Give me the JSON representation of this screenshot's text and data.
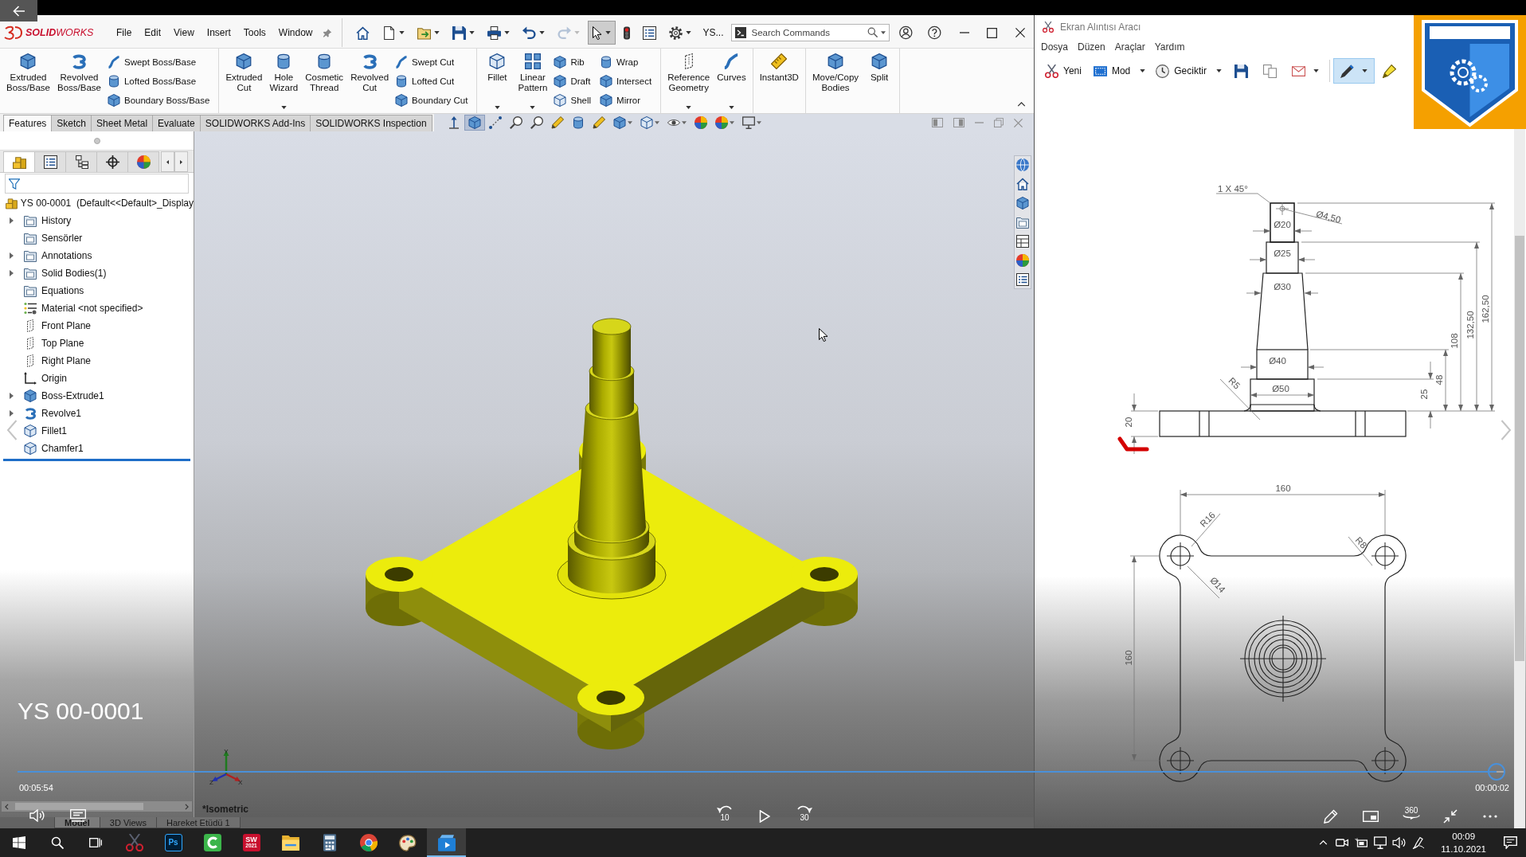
{
  "player": {
    "title": "YS 00-0001",
    "elapsed": "00:05:54",
    "remaining": "00:00:02",
    "level": 0.994,
    "rewind_label": "10",
    "forward_label": "30",
    "view360_label": "360"
  },
  "solidworks": {
    "brand": "**SOLID**WORKS",
    "menu": [
      "File",
      "Edit",
      "View",
      "Insert",
      "Tools",
      "Window"
    ],
    "quick_access": [
      {
        "kind": "home",
        "dropdown": false,
        "selected": false,
        "disabled": false
      },
      {
        "kind": "new",
        "dropdown": true,
        "selected": false,
        "disabled": false
      },
      {
        "kind": "open",
        "dropdown": true,
        "selected": false,
        "disabled": false
      },
      {
        "kind": "save",
        "dropdown": true,
        "selected": false,
        "disabled": false
      },
      {
        "kind": "print",
        "dropdown": true,
        "selected": false,
        "disabled": false
      },
      {
        "kind": "undo",
        "dropdown": true,
        "selected": false,
        "disabled": false
      },
      {
        "kind": "redo",
        "dropdown": true,
        "selected": false,
        "disabled": true
      },
      {
        "kind": "select",
        "dropdown": true,
        "selected": true,
        "disabled": false
      },
      {
        "kind": "rebuild",
        "dropdown": false,
        "selected": false,
        "disabled": false
      },
      {
        "kind": "file_properties",
        "dropdown": false,
        "selected": false,
        "disabled": false
      },
      {
        "kind": "options",
        "dropdown": true,
        "selected": false,
        "disabled": false
      }
    ],
    "document_label": "YS...",
    "search": {
      "placeholder": "Search Commands"
    },
    "ribbon": [
      [
        {
          "kind": "large",
          "label": "Extruded\nBoss/Base",
          "dropdown": false
        },
        {
          "kind": "large",
          "label": "Revolved\nBoss/Base",
          "dropdown": false
        },
        {
          "kind": "stack",
          "items": [
            "Swept Boss/Base",
            "Lofted Boss/Base",
            "Boundary Boss/Base"
          ]
        }
      ],
      [
        {
          "kind": "large",
          "label": "Extruded\nCut",
          "dropdown": false
        },
        {
          "kind": "large",
          "label": "Hole\nWizard",
          "dropdown": true
        },
        {
          "kind": "large",
          "label": "Cosmetic\nThread",
          "dropdown": false
        },
        {
          "kind": "large",
          "label": "Revolved\nCut",
          "dropdown": false
        },
        {
          "kind": "stack",
          "items": [
            "Swept Cut",
            "Lofted Cut",
            "Boundary Cut"
          ]
        }
      ],
      [
        {
          "kind": "large",
          "label": "Fillet",
          "dropdown": true
        },
        {
          "kind": "large",
          "label": "Linear\nPattern",
          "dropdown": true
        },
        {
          "kind": "stack",
          "items": [
            "Rib",
            "Draft",
            "Shell"
          ]
        },
        {
          "kind": "stack",
          "items": [
            "Wrap",
            "Intersect",
            "Mirror"
          ]
        }
      ],
      [
        {
          "kind": "large",
          "label": "Reference\nGeometry",
          "dropdown": true
        },
        {
          "kind": "large",
          "label": "Curves",
          "dropdown": true
        }
      ],
      [
        {
          "kind": "large",
          "label": "Instant3D",
          "dropdown": false
        }
      ],
      [
        {
          "kind": "large",
          "label": "Move/Copy\nBodies",
          "dropdown": false
        },
        {
          "kind": "large",
          "label": "Split",
          "dropdown": false
        }
      ]
    ],
    "tabs": [
      {
        "label": "Features",
        "selected": true
      },
      {
        "label": "Sketch",
        "selected": false
      },
      {
        "label": "Sheet Metal",
        "selected": false
      },
      {
        "label": "Evaluate",
        "selected": false
      },
      {
        "label": "SOLIDWORKS Add-Ins",
        "selected": false
      },
      {
        "label": "SOLIDWORKS Inspection",
        "selected": false
      }
    ],
    "view_tools": [
      {
        "selected": false,
        "dropdown": false
      },
      {
        "selected": true,
        "dropdown": false
      },
      {
        "selected": false,
        "dropdown": false
      },
      {
        "selected": false,
        "dropdown": false
      },
      {
        "selected": false,
        "dropdown": false
      },
      {
        "selected": false,
        "dropdown": false
      },
      {
        "selected": false,
        "dropdown": false
      },
      {
        "selected": false,
        "dropdown": false
      },
      {
        "selected": false,
        "dropdown": true
      },
      {
        "selected": false,
        "dropdown": true
      },
      {
        "selected": false,
        "dropdown": true
      },
      {
        "selected": false,
        "dropdown": false
      },
      {
        "selected": false,
        "dropdown": true
      },
      {
        "selected": false,
        "dropdown": true
      }
    ],
    "panel_tabs": [
      {
        "selected": true
      },
      {
        "selected": false
      },
      {
        "selected": false
      },
      {
        "selected": false
      },
      {
        "selected": false
      }
    ],
    "tree": {
      "root": "YS 00-0001  (Default<<Default>_Display",
      "items": [
        {
          "label": "History",
          "kind": "folder",
          "expandable": true
        },
        {
          "label": "Sensörler",
          "kind": "folder",
          "expandable": false
        },
        {
          "label": "Annotations",
          "kind": "folder",
          "expandable": true
        },
        {
          "label": "Solid Bodies(1)",
          "kind": "folder",
          "expandable": true
        },
        {
          "label": "Equations",
          "kind": "folder",
          "expandable": false
        },
        {
          "label": "Material <not specified>",
          "kind": "material",
          "expandable": false
        },
        {
          "label": "Front Plane",
          "kind": "plane",
          "expandable": false
        },
        {
          "label": "Top Plane",
          "kind": "plane",
          "expandable": false
        },
        {
          "label": "Right Plane",
          "kind": "plane",
          "expandable": false
        },
        {
          "label": "Origin",
          "kind": "origin",
          "expandable": false
        },
        {
          "label": "Boss-Extrude1",
          "kind": "extrude",
          "expandable": true
        },
        {
          "label": "Revolve1",
          "kind": "revolve",
          "expandable": true
        },
        {
          "label": "Fillet1",
          "kind": "fillet",
          "expandable": false
        },
        {
          "label": "Chamfer1",
          "kind": "chamfer",
          "expandable": false
        }
      ]
    },
    "view_name": "*Isometric",
    "triad": [
      "Y",
      "Z",
      "X"
    ],
    "bottom_tabs": [
      {
        "label": "Model",
        "selected": true
      },
      {
        "label": "3D Views",
        "selected": false
      },
      {
        "label": "Hareket Etüdü 1",
        "selected": false
      }
    ]
  },
  "snipping_tool": {
    "title": "Ekran Alıntısı Aracı",
    "menu": [
      "Dosya",
      "Düzen",
      "Araçlar",
      "Yardım"
    ],
    "tools": [
      {
        "kind": "new",
        "label": "Yeni",
        "dropdown": false,
        "selected": false
      },
      {
        "kind": "mode",
        "label": "Mod",
        "dropdown": true,
        "selected": false
      },
      {
        "kind": "delay",
        "label": "Geciktir",
        "dropdown": true,
        "selected": false
      },
      {
        "kind": "save",
        "dropdown": false,
        "selected": false
      },
      {
        "kind": "copy",
        "dropdown": false,
        "selected": false
      },
      {
        "kind": "send",
        "dropdown": true,
        "selected": false
      },
      {
        "kind": "pen",
        "dropdown": true,
        "selected": true
      },
      {
        "kind": "highlighter",
        "dropdown": false,
        "selected": false
      }
    ],
    "drawing": {
      "side_view": [
        "1 X 45°",
        "Ø4,50",
        "Ø20",
        "Ø25",
        "Ø30",
        "Ø40",
        "Ø50",
        "R5",
        "20",
        "25",
        "48",
        "108",
        "132,50",
        "162,50"
      ],
      "top_view": [
        "160",
        "R16",
        "R8",
        "Ø14",
        "160"
      ]
    }
  },
  "taskbar": {
    "apps": [
      {
        "kind": "snipping_tool",
        "selected": false
      },
      {
        "kind": "photoshop",
        "label": "Ps",
        "selected": false
      },
      {
        "kind": "camtasia",
        "selected": false
      },
      {
        "kind": "solidworks",
        "label": "SW",
        "sublabel": "2021",
        "selected": false
      },
      {
        "kind": "file_explorer",
        "selected": false
      },
      {
        "kind": "calculator",
        "selected": false
      },
      {
        "kind": "chrome",
        "selected": false
      },
      {
        "kind": "paint",
        "selected": false
      },
      {
        "kind": "video_player",
        "selected": true
      }
    ],
    "time": "00:09",
    "date": "11.10.2021"
  }
}
